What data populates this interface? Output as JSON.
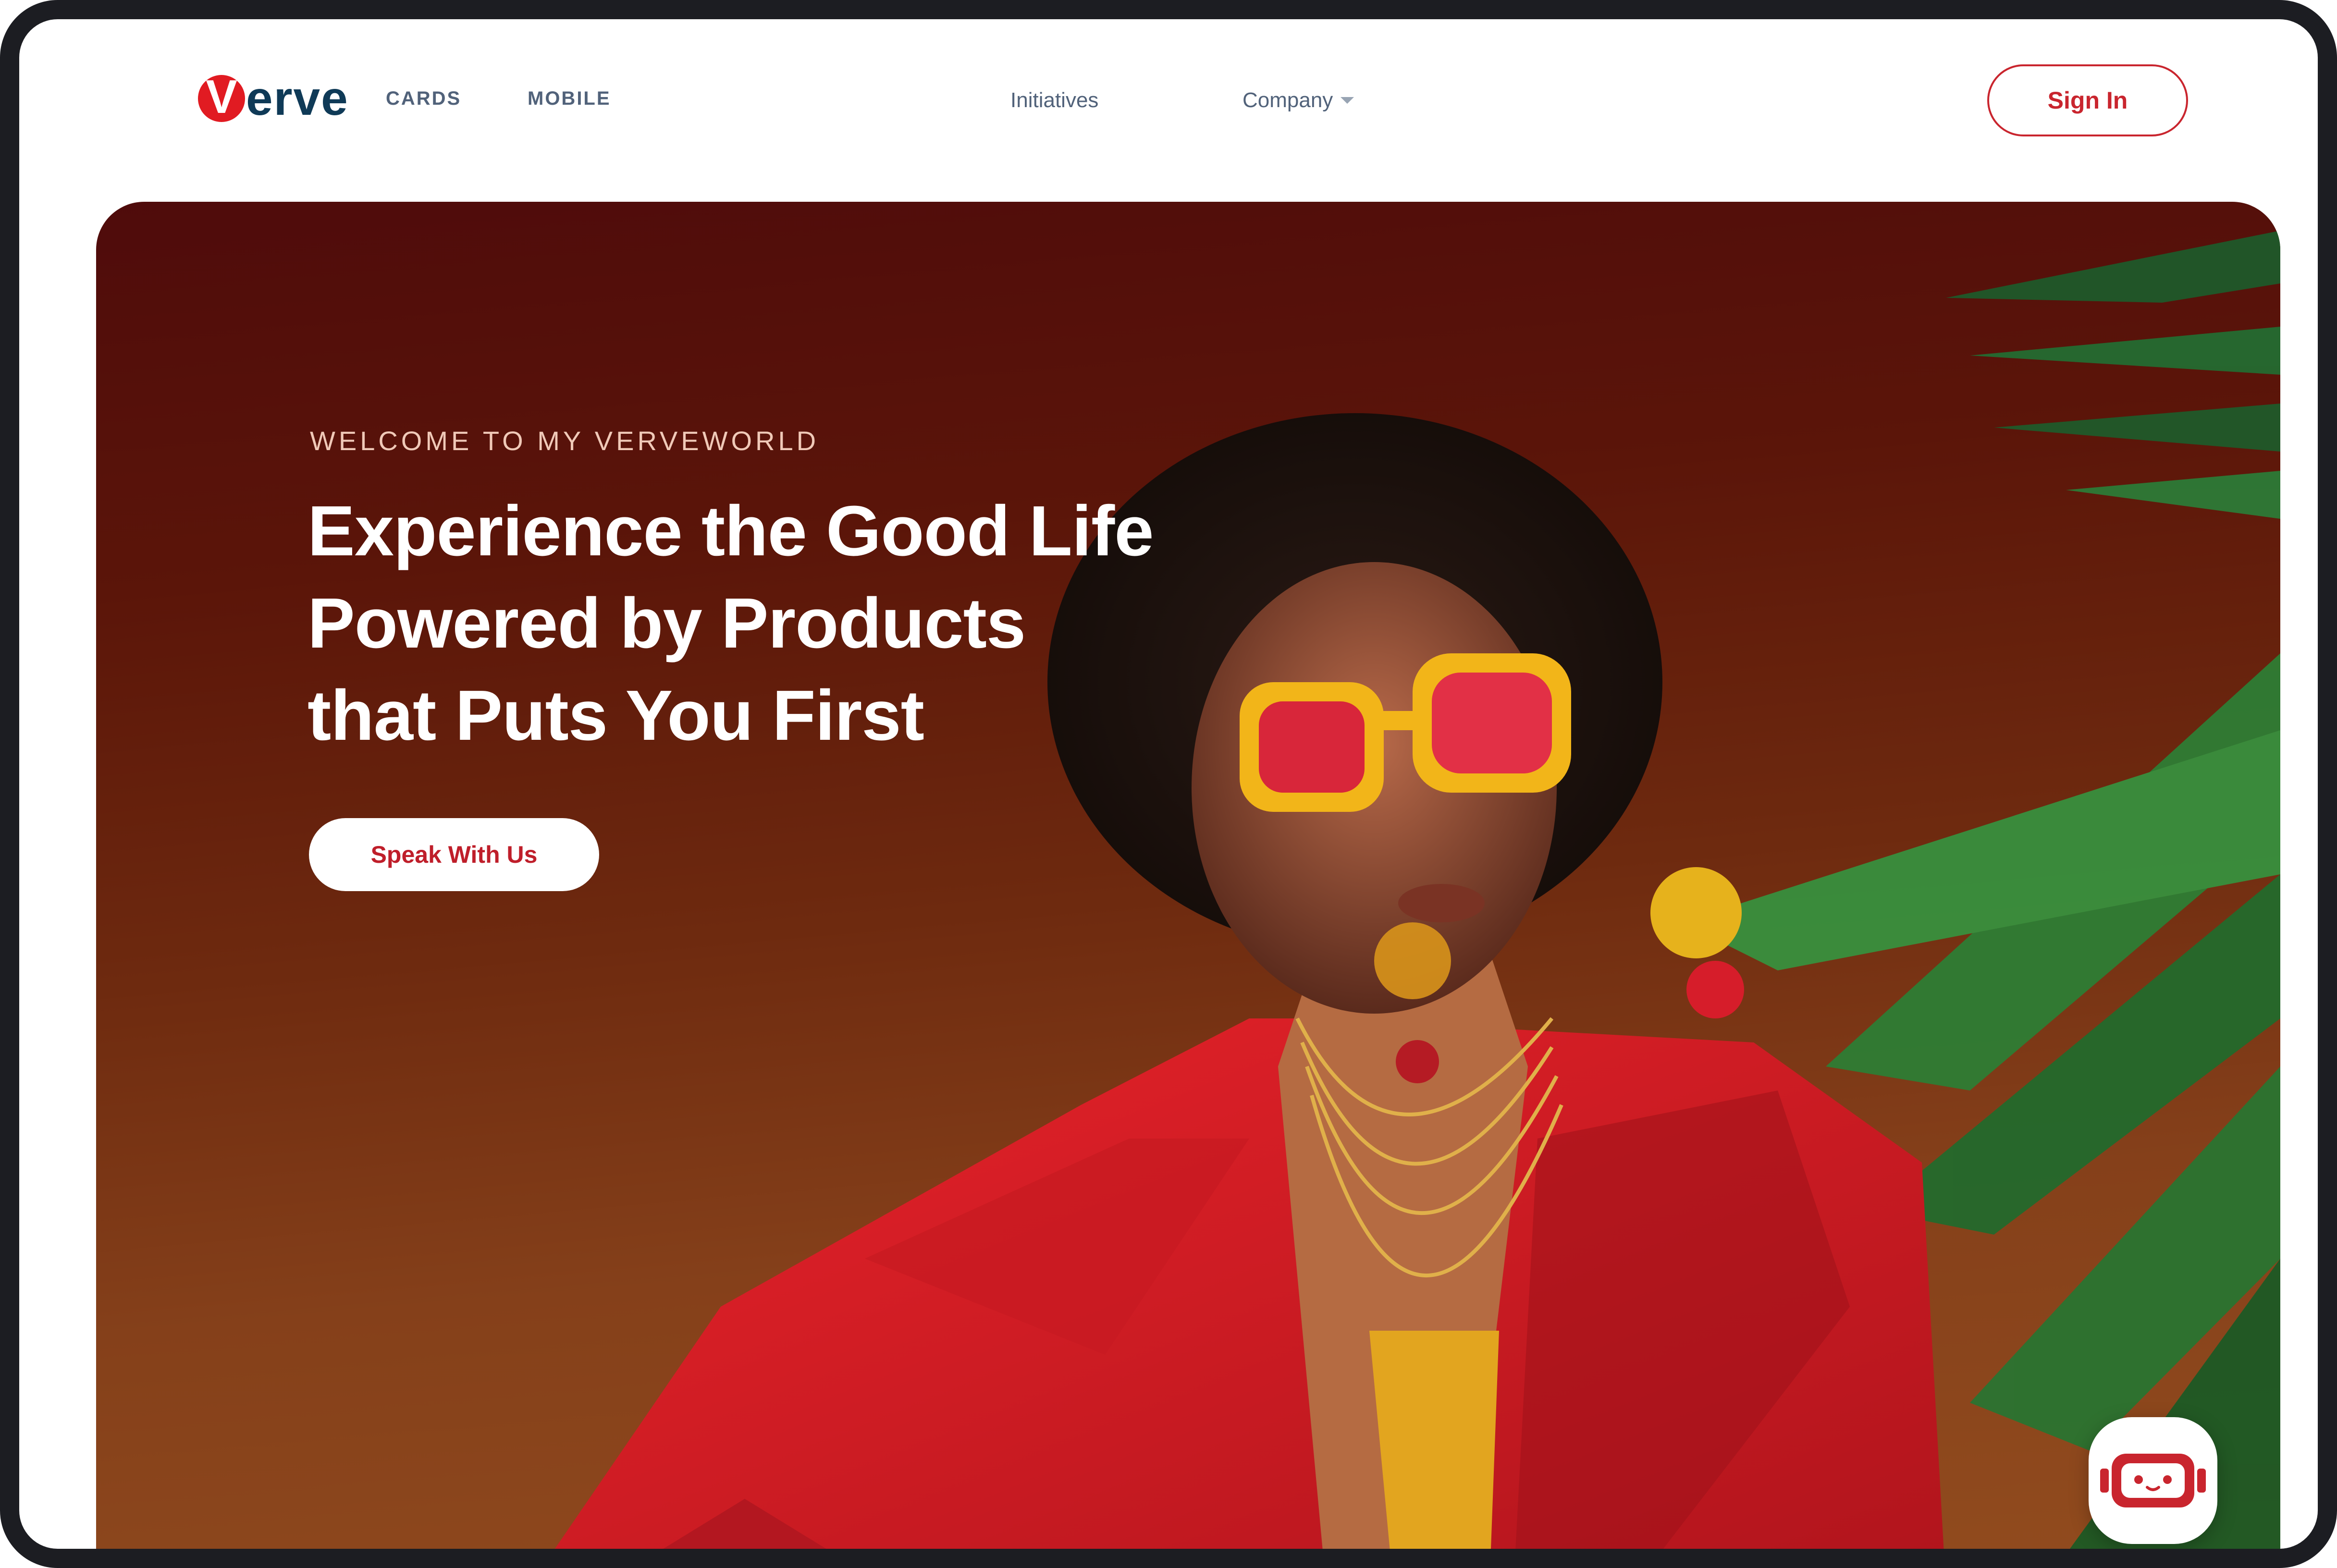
{
  "brand": {
    "logo_mark": "V",
    "logo_rest": "erve",
    "red": "#e11b22",
    "navy": "#0f3a57"
  },
  "nav": {
    "cards": "CARDS",
    "mobile": "MOBILE",
    "initiatives": "Initiatives",
    "company": "Company",
    "sign_in": "Sign In"
  },
  "hero": {
    "eyebrow": "WELCOME TO MY VERVEWORLD",
    "headline_lines": [
      "Experience the Good Life",
      "Powered by Products",
      "that Puts You First"
    ],
    "cta": "Speak With Us",
    "image": "woman-in-red-suit-and-yellow-sunglasses",
    "accent_red": "#c9252e"
  },
  "chatbot": {
    "icon": "robot-face-icon"
  }
}
